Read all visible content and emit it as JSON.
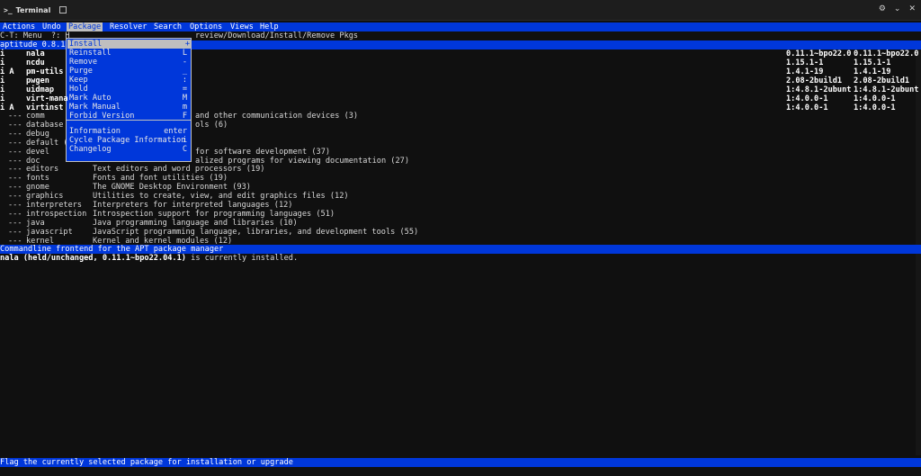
{
  "window": {
    "title": "Terminal",
    "right_icons": [
      "gear-icon",
      "chevron-down-icon",
      "close-icon"
    ]
  },
  "menubar": {
    "items": [
      "Actions",
      "Undo",
      "Package",
      "Resolver",
      "Search",
      "Options",
      "Views",
      "Help"
    ],
    "active": "Package"
  },
  "hint_line": {
    "left": "C-T: Menu  ?: H",
    "right": "review/Download/Install/Remove Pkgs"
  },
  "header_line": "aptitude 0.8.13",
  "packages": [
    {
      "state": "i",
      "name": "nala",
      "installed": "0.11.1~bpo22.0",
      "candidate": "0.11.1~bpo22.0"
    },
    {
      "state": "i",
      "name": "ncdu",
      "installed": "1.15.1-1",
      "candidate": "1.15.1-1"
    },
    {
      "state": "i A",
      "name": "pm-utils",
      "installed": "1.4.1-19",
      "candidate": "1.4.1-19"
    },
    {
      "state": "i",
      "name": "pwgen",
      "installed": "2.08-2build1",
      "candidate": "2.08-2build1"
    },
    {
      "state": "i",
      "name": "uidmap",
      "installed": "1:4.8.1-2ubunt",
      "candidate": "1:4.8.1-2ubunt"
    },
    {
      "state": "i",
      "name": "virt-mana",
      "installed": "1:4.0.0-1",
      "candidate": "1:4.0.0-1"
    },
    {
      "state": "i A",
      "name": "virtinst",
      "installed": "1:4.0.0-1",
      "candidate": "1:4.0.0-1"
    }
  ],
  "sections": [
    {
      "prefix": "---",
      "name": "comm",
      "desc": "and other communication devices (3)"
    },
    {
      "prefix": "---",
      "name": "database",
      "desc": "ols (6)"
    },
    {
      "prefix": "---",
      "name": "debug",
      "desc": ""
    },
    {
      "prefix": "---",
      "name": "default (",
      "desc": ""
    },
    {
      "prefix": "---",
      "name": "devel",
      "desc": "for software development (37)"
    },
    {
      "prefix": "---",
      "name": "doc",
      "desc": "alized programs for viewing documentation (27)"
    },
    {
      "prefix": "---",
      "name": "editors",
      "desc": "Text editors and word processors (19)"
    },
    {
      "prefix": "---",
      "name": "fonts",
      "desc": "Fonts and font utilities (19)"
    },
    {
      "prefix": "---",
      "name": "gnome",
      "desc": "The GNOME Desktop Environment (93)"
    },
    {
      "prefix": "---",
      "name": "graphics",
      "desc": "Utilities to create, view, and edit graphics files (12)"
    },
    {
      "prefix": "---",
      "name": "interpreters",
      "desc": "Interpreters for interpreted languages (12)"
    },
    {
      "prefix": "---",
      "name": "introspection",
      "desc": "Introspection support for programming languages (51)"
    },
    {
      "prefix": "---",
      "name": "java",
      "desc": "Java programming language and libraries (10)"
    },
    {
      "prefix": "---",
      "name": "javascript",
      "desc": "JavaScript programming language, libraries, and development tools (55)"
    },
    {
      "prefix": "---",
      "name": "kernel",
      "desc": "Kernel and kernel modules (12)"
    }
  ],
  "description_bar": "Commandline frontend for the APT package manager",
  "info_line": {
    "bold": "nala (held/unchanged, 0.11.1~bpo22.04.1)",
    "rest": " is currently installed."
  },
  "status_line": "Flag the currently selected package for installation or upgrade",
  "package_menu": [
    {
      "label": "Install",
      "key": "+",
      "selected": true
    },
    {
      "label": "Reinstall",
      "key": "L"
    },
    {
      "label": "Remove",
      "key": "-"
    },
    {
      "label": "Purge",
      "key": "_"
    },
    {
      "label": "Keep",
      "key": ":"
    },
    {
      "label": "Hold",
      "key": "="
    },
    {
      "label": "Mark Auto",
      "key": "M"
    },
    {
      "label": "Mark Manual",
      "key": "m"
    },
    {
      "label": "Forbid Version",
      "key": "F"
    },
    {
      "label": "Information",
      "key": "enter"
    },
    {
      "label": "Cycle Package Information",
      "key": "i"
    },
    {
      "label": "Changelog",
      "key": "C"
    }
  ]
}
